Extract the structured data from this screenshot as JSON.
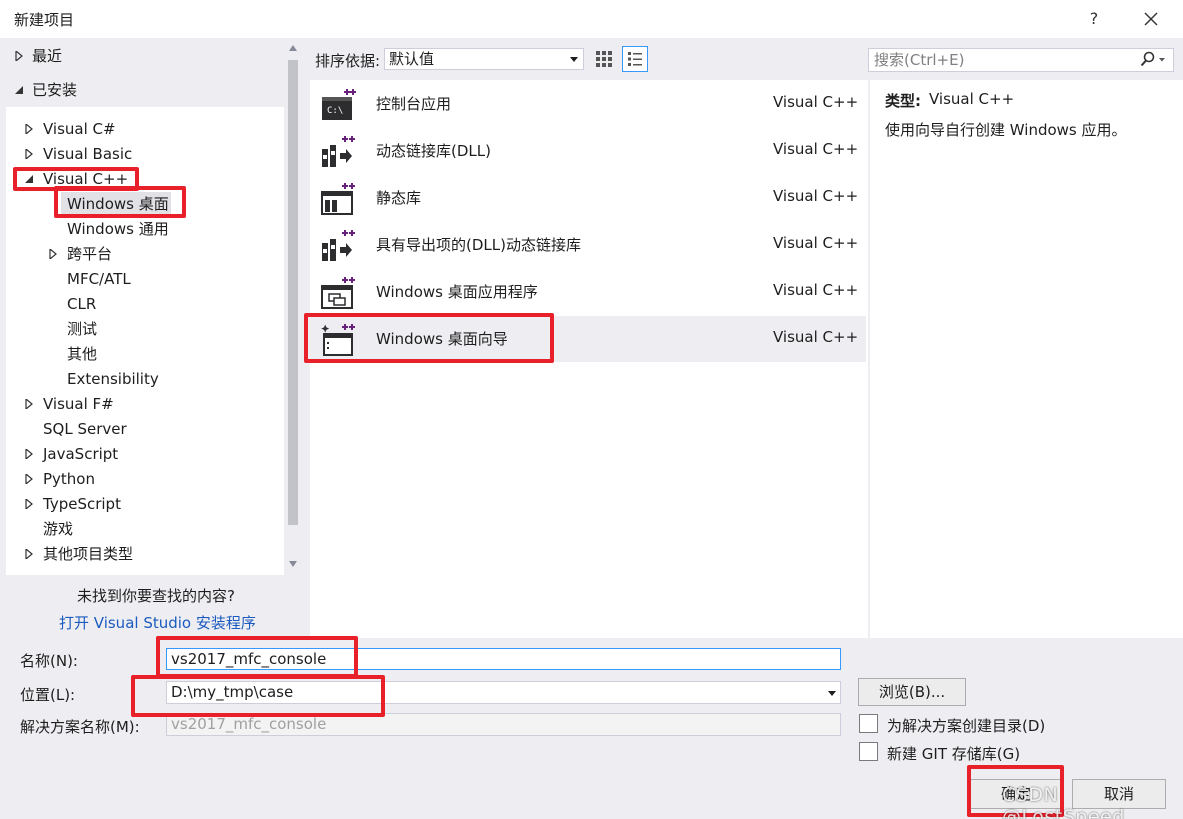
{
  "window": {
    "title": "新建项目",
    "help": "?",
    "colors": {
      "accent": "#3399ff",
      "annotation": "#e8202a",
      "link": "#1b5bbf",
      "panel": "#eeeef2"
    }
  },
  "nav": {
    "recent": "最近",
    "installed": "已安装",
    "tree": [
      {
        "label": "Visual C#"
      },
      {
        "label": "Visual Basic"
      },
      {
        "label": "Visual C++"
      },
      {
        "label": "Windows 桌面"
      },
      {
        "label": "Windows 通用"
      },
      {
        "label": "跨平台"
      },
      {
        "label": "MFC/ATL"
      },
      {
        "label": "CLR"
      },
      {
        "label": "测试"
      },
      {
        "label": "其他"
      },
      {
        "label": "Extensibility"
      },
      {
        "label": "Visual F#"
      },
      {
        "label": "SQL Server"
      },
      {
        "label": "JavaScript"
      },
      {
        "label": "Python"
      },
      {
        "label": "TypeScript"
      },
      {
        "label": "游戏"
      },
      {
        "label": "其他项目类型"
      }
    ],
    "not_found": "未找到你要查找的内容?",
    "open_installer": "打开 Visual Studio 安装程序"
  },
  "toolbar": {
    "sort_label": "排序依据:",
    "sort_value": "默认值",
    "search_placeholder": "搜索(Ctrl+E)"
  },
  "templates": [
    {
      "name": "控制台应用",
      "lang": "Visual C++",
      "icon": "console-app-icon"
    },
    {
      "name": "动态链接库(DLL)",
      "lang": "Visual C++",
      "icon": "dll-icon"
    },
    {
      "name": "静态库",
      "lang": "Visual C++",
      "icon": "static-lib-icon"
    },
    {
      "name": "具有导出项的(DLL)动态链接库",
      "lang": "Visual C++",
      "icon": "dll-exports-icon"
    },
    {
      "name": "Windows 桌面应用程序",
      "lang": "Visual C++",
      "icon": "desktop-app-icon"
    },
    {
      "name": "Windows 桌面向导",
      "lang": "Visual C++",
      "icon": "desktop-wizard-icon"
    }
  ],
  "description": {
    "type_label": "类型:",
    "type_value": "Visual C++",
    "text": "使用向导自行创建 Windows 应用。"
  },
  "form": {
    "name_label": "名称(N):",
    "name_value": "vs2017_mfc_console",
    "location_label": "位置(L):",
    "location_value": "D:\\my_tmp\\case",
    "solution_label": "解决方案名称(M):",
    "solution_value": "vs2017_mfc_console",
    "browse": "浏览(B)...",
    "create_dir": "为解决方案创建目录(D)",
    "git_repo": "新建 GIT 存储库(G)",
    "ok": "确定",
    "cancel": "取消"
  },
  "watermark": "CSDN @LostSpeed"
}
